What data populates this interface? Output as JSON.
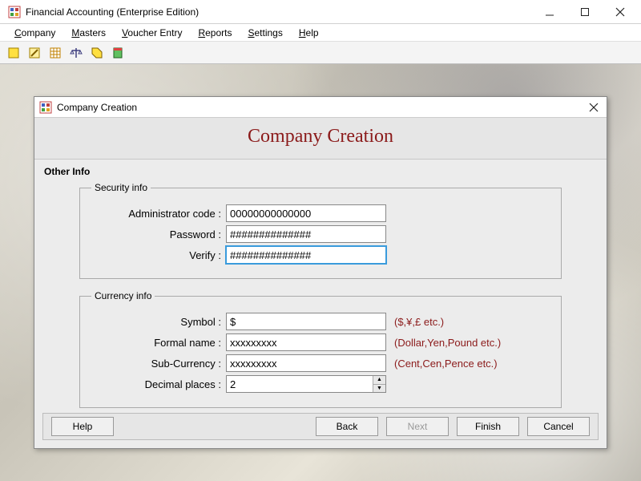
{
  "window": {
    "title": "Financial Accounting (Enterprise Edition)"
  },
  "menubar": {
    "items": [
      {
        "label": "Company",
        "accel": "C"
      },
      {
        "label": "Masters",
        "accel": "M"
      },
      {
        "label": "Voucher Entry",
        "accel": "V"
      },
      {
        "label": "Reports",
        "accel": "R"
      },
      {
        "label": "Settings",
        "accel": "S"
      },
      {
        "label": "Help",
        "accel": "H"
      }
    ]
  },
  "dialog": {
    "title": "Company Creation",
    "heading": "Company Creation",
    "section_label": "Other Info",
    "security": {
      "legend": "Security info",
      "admin_code_label": "Administrator code :",
      "admin_code_value": "00000000000000",
      "password_label": "Password :",
      "password_value": "##############",
      "verify_label": "Verify :",
      "verify_value": "##############"
    },
    "currency": {
      "legend": "Currency info",
      "symbol_label": "Symbol :",
      "symbol_value": "$",
      "symbol_hint": "($,¥,£ etc.)",
      "formal_label": "Formal name :",
      "formal_value": "xxxxxxxxx",
      "formal_hint": "(Dollar,Yen,Pound etc.)",
      "sub_label": "Sub-Currency :",
      "sub_value": "xxxxxxxxx",
      "sub_hint": "(Cent,Cen,Pence etc.)",
      "decimal_label": "Decimal places :",
      "decimal_value": "2"
    },
    "buttons": {
      "help": "Help",
      "back": "Back",
      "next": "Next",
      "finish": "Finish",
      "cancel": "Cancel"
    }
  }
}
